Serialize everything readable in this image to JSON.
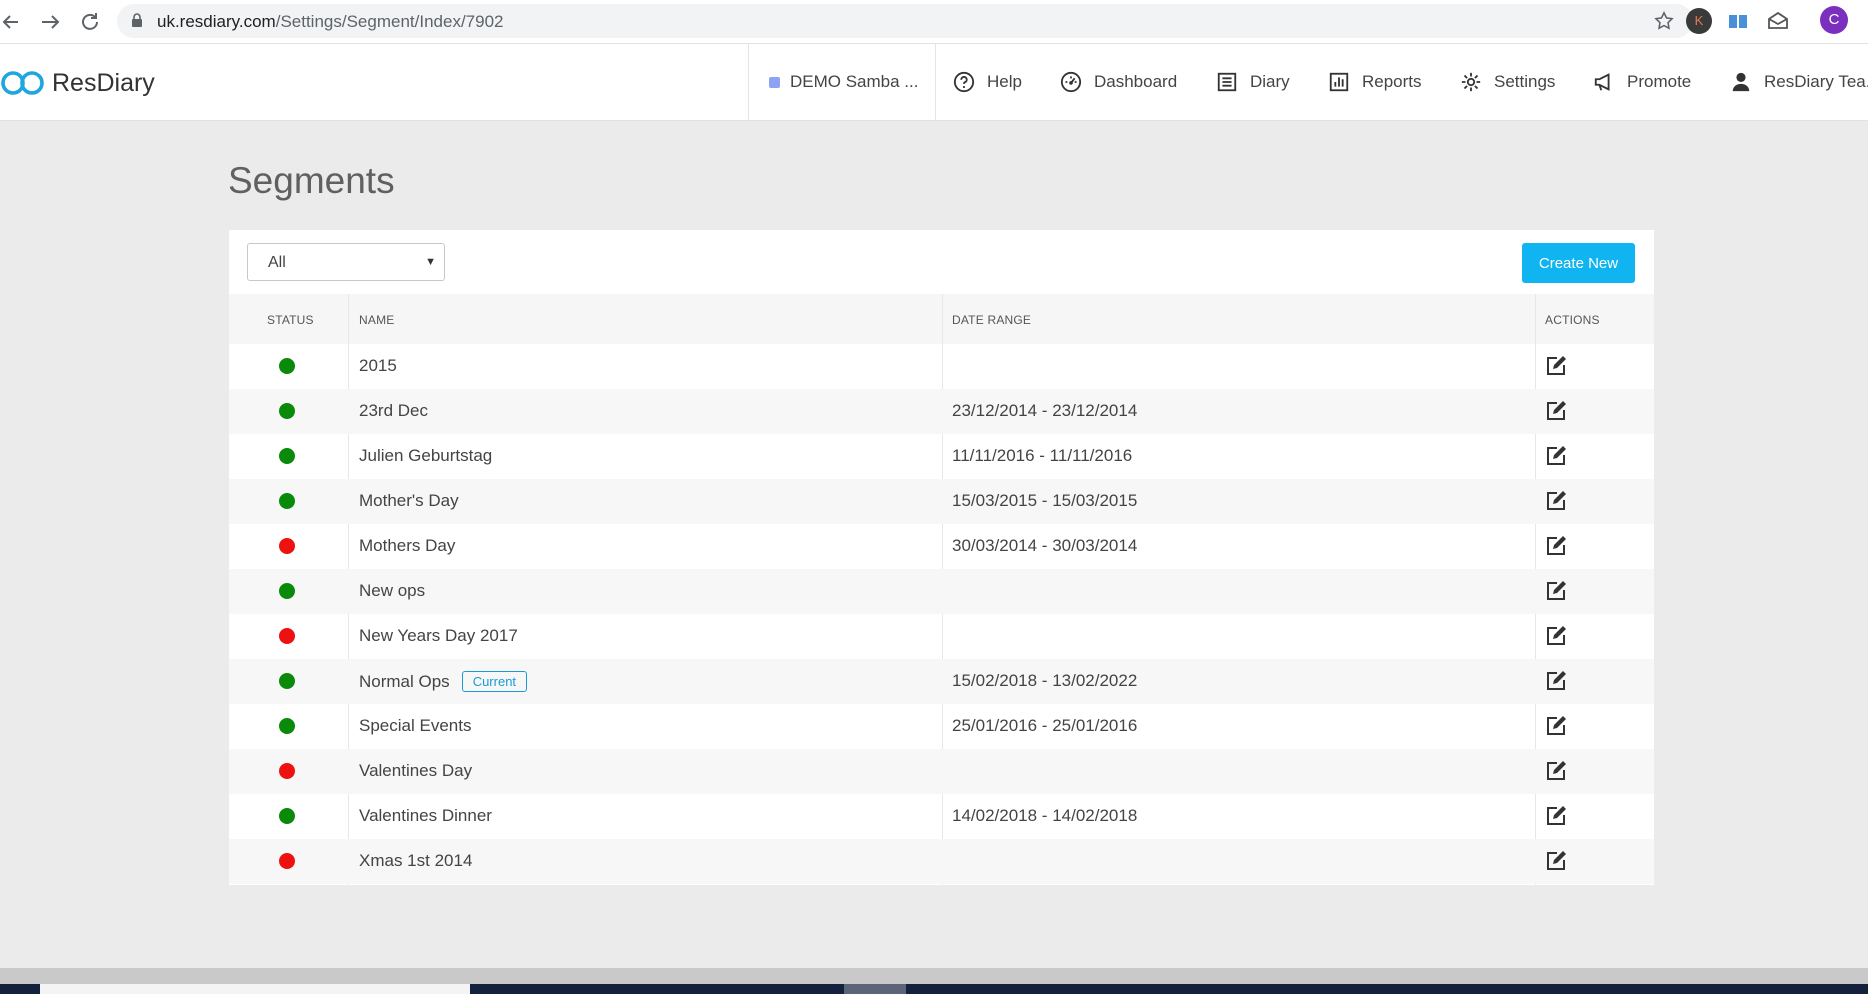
{
  "browser": {
    "url_host": "uk.resdiary.com",
    "url_path": "/Settings/Segment/Index/7902",
    "extension_k_label": "K",
    "profile_initial": "C"
  },
  "header": {
    "logo_text": "ResDiary",
    "restaurant": "DEMO Samba ...",
    "nav": [
      {
        "label": "Help",
        "icon": "help-circle-icon"
      },
      {
        "label": "Dashboard",
        "icon": "dashboard-icon"
      },
      {
        "label": "Diary",
        "icon": "diary-icon"
      },
      {
        "label": "Reports",
        "icon": "reports-icon"
      },
      {
        "label": "Settings",
        "icon": "gear-icon"
      },
      {
        "label": "Promote",
        "icon": "megaphone-icon"
      },
      {
        "label": "ResDiary Tea...",
        "icon": "user-icon"
      }
    ]
  },
  "page": {
    "title": "Segments",
    "filter_value": "All",
    "create_button": "Create New",
    "columns": {
      "status": "STATUS",
      "name": "NAME",
      "date_range": "DATE RANGE",
      "actions": "ACTIONS"
    },
    "status_colors": {
      "active": "#0a8a0a",
      "inactive": "#ee1111"
    },
    "badge_current": "Current",
    "rows": [
      {
        "status": "active",
        "name": "2015",
        "date_range": ""
      },
      {
        "status": "active",
        "name": "23rd Dec",
        "date_range": "23/12/2014 - 23/12/2014"
      },
      {
        "status": "active",
        "name": "Julien Geburtstag",
        "date_range": "11/11/2016 - 11/11/2016"
      },
      {
        "status": "active",
        "name": "Mother's Day",
        "date_range": "15/03/2015 - 15/03/2015"
      },
      {
        "status": "inactive",
        "name": "Mothers Day",
        "date_range": "30/03/2014 - 30/03/2014"
      },
      {
        "status": "active",
        "name": "New ops",
        "date_range": ""
      },
      {
        "status": "inactive",
        "name": "New Years Day 2017",
        "date_range": ""
      },
      {
        "status": "active",
        "name": "Normal Ops",
        "date_range": "15/02/2018 - 13/02/2022",
        "current": true
      },
      {
        "status": "active",
        "name": "Special Events",
        "date_range": "25/01/2016 - 25/01/2016"
      },
      {
        "status": "inactive",
        "name": "Valentines Day",
        "date_range": ""
      },
      {
        "status": "active",
        "name": "Valentines Dinner",
        "date_range": "14/02/2018 - 14/02/2018"
      },
      {
        "status": "inactive",
        "name": "Xmas 1st 2014",
        "date_range": ""
      }
    ]
  }
}
